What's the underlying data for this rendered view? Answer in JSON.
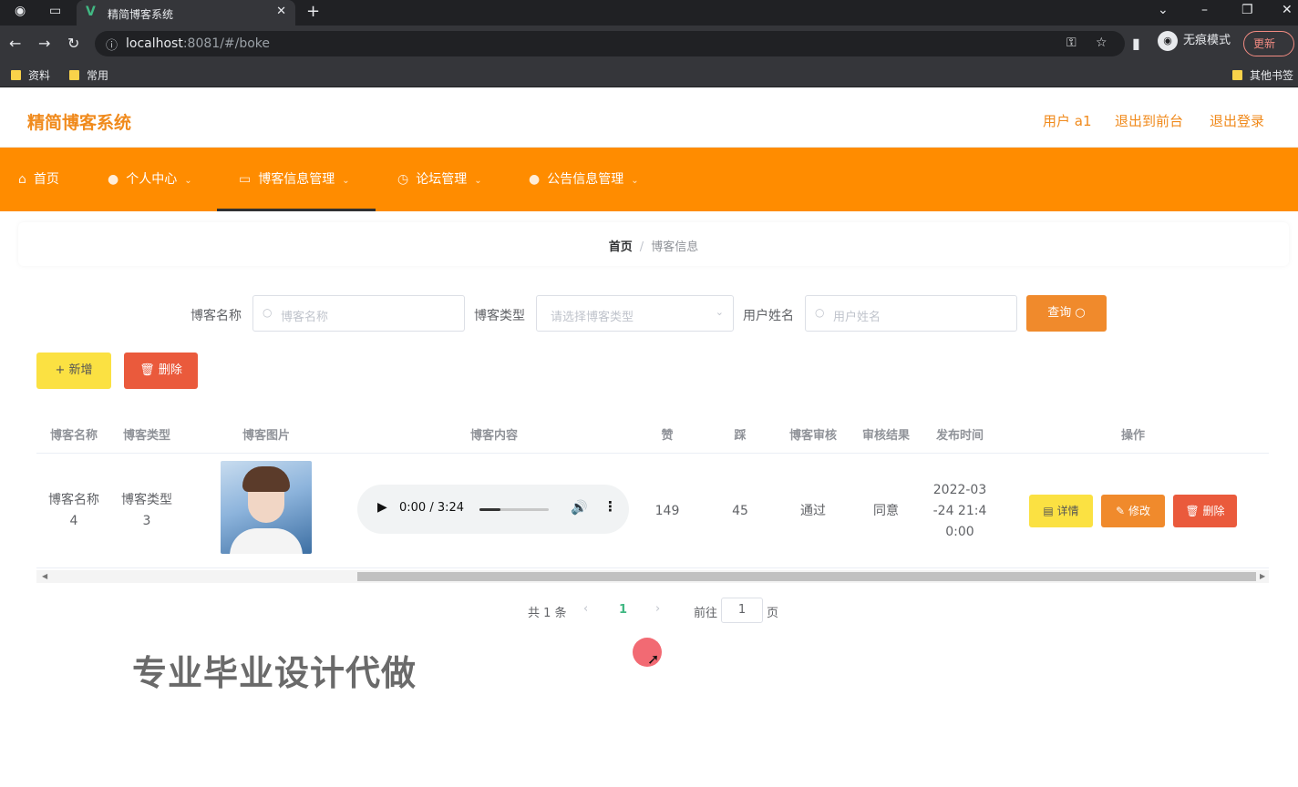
{
  "browser": {
    "tab_title": "精简博客系统",
    "url_host": "localhost",
    "url_rest": ":8081/#/boke",
    "incognito_label": "无痕模式",
    "update_label": "更新",
    "bookmarks": [
      "资料",
      "常用"
    ],
    "other_bookmarks": "其他书签"
  },
  "header": {
    "title": "精简博客系统",
    "user_label": "用户 a1",
    "back_to_front": "退出到前台",
    "logout": "退出登录"
  },
  "nav": {
    "items": [
      {
        "label": "首页",
        "icon": "home-icon"
      },
      {
        "label": "个人中心",
        "icon": "user-icon"
      },
      {
        "label": "博客信息管理",
        "icon": "document-icon"
      },
      {
        "label": "论坛管理",
        "icon": "forum-icon"
      },
      {
        "label": "公告信息管理",
        "icon": "notice-icon"
      }
    ],
    "active": "博客信息管理"
  },
  "breadcrumb": {
    "home": "首页",
    "separator": "/",
    "current": "博客信息"
  },
  "search": {
    "name_label": "博客名称",
    "name_placeholder": "博客名称",
    "type_label": "博客类型",
    "type_placeholder": "请选择博客类型",
    "user_label": "用户姓名",
    "user_placeholder": "用户姓名",
    "query_button": "查询"
  },
  "actions": {
    "add_button": "新增",
    "delete_button": "删除"
  },
  "table": {
    "headers": [
      "博客名称",
      "博客类型",
      "博客图片",
      "博客内容",
      "赞",
      "踩",
      "博客审核",
      "审核结果",
      "发布时间",
      "操作"
    ],
    "rows": [
      {
        "name_line1": "博客名称",
        "name_line2": "4",
        "type_line1": "博客类型",
        "type_line2": "3",
        "audio_time": "0:00 / 3:24",
        "audio_progress": 0.3,
        "likes": "149",
        "dislikes": "45",
        "review": "通过",
        "result": "同意",
        "time_line1": "2022-03",
        "time_line2": "-24 21:4",
        "time_line3": "0:00",
        "detail_button": "详情",
        "edit_button": "修改",
        "delete_button": "删除"
      }
    ]
  },
  "pagination": {
    "total": "共 1 条",
    "current_page": "1",
    "goto_label": "前往",
    "goto_value": "1",
    "page_unit": "页"
  },
  "watermark": "专业毕业设计代做",
  "colors": {
    "brand_orange": "#ff8c00",
    "query_orange": "#f08a2c",
    "yellow_button": "#fbe142",
    "red_button": "#ea5a3c",
    "page_green": "#41b883"
  }
}
